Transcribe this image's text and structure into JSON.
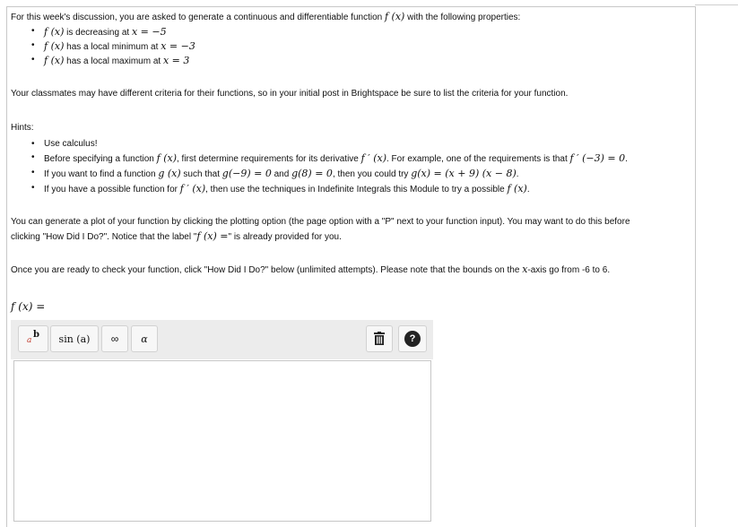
{
  "intro": {
    "lead": "For this week's discussion, you are asked to generate a continuous and differentiable function ",
    "fx": "f (x)",
    "tail": " with the following properties:"
  },
  "properties": [
    {
      "fx": "f (x)",
      "text": " is decreasing at ",
      "cond": "x = −5"
    },
    {
      "fx": "f (x)",
      "text": " has a local minimum at ",
      "cond": "x = −3"
    },
    {
      "fx": "f (x)",
      "text": " has a local maximum at ",
      "cond": "x = 3"
    }
  ],
  "classmates_note": "Your classmates may have different criteria for their functions, so in your initial post in Brightspace be sure to list the criteria for your function.",
  "hints": {
    "label": "Hints:",
    "h1": "Use calculus!",
    "h2a": "Before specifying a function ",
    "h2fx": "f (x)",
    "h2b": ", first determine requirements for its derivative ",
    "h2fp": "f ′ (x)",
    "h2c": ". For example, one of the requirements is that ",
    "h2eq": "f ′ (−3) = 0",
    "h2d": ".",
    "h3a": "If you want to find a function ",
    "h3g": "g (x)",
    "h3b": " such that ",
    "h3e1": "g(−9) = 0",
    "h3c": " and ",
    "h3e2": "g(8) = 0",
    "h3d": ", then you could try ",
    "h3e3": "g(x) = (x + 9) (x − 8)",
    "h3f": ".",
    "h4a": "If you have a possible function for ",
    "h4fp": "f ′ (x)",
    "h4b": ", then use the techniques in Indefinite Integrals this Module to try a possible ",
    "h4fx": "f (x)",
    "h4c": "."
  },
  "plot_note": {
    "line1": "You can generate a plot of your function by clicking the plotting option (the page option with a \"P\" next to your function input). You may want to do this before",
    "line2a": "clicking \"How Did I Do?\". Notice that the label \"",
    "line2fx": "f (x) =",
    "line2b": "\" is already provided for you."
  },
  "ready_note": {
    "a": "Once you are ready to check your function, click \"How Did I Do?\" below (unlimited attempts). Please note that the bounds on the ",
    "x": "x",
    "b": "-axis go from -6 to 6."
  },
  "answer_label": "f (x) =",
  "toolbar": {
    "superscript": {
      "base": "a",
      "exp": "b"
    },
    "sin": "sin (a)",
    "infinity": "∞",
    "alpha": "α",
    "help": "?"
  },
  "colors": {
    "superscript_base": "#c0392b",
    "help_bg": "#222222",
    "toolbar_bg": "#ececec"
  }
}
